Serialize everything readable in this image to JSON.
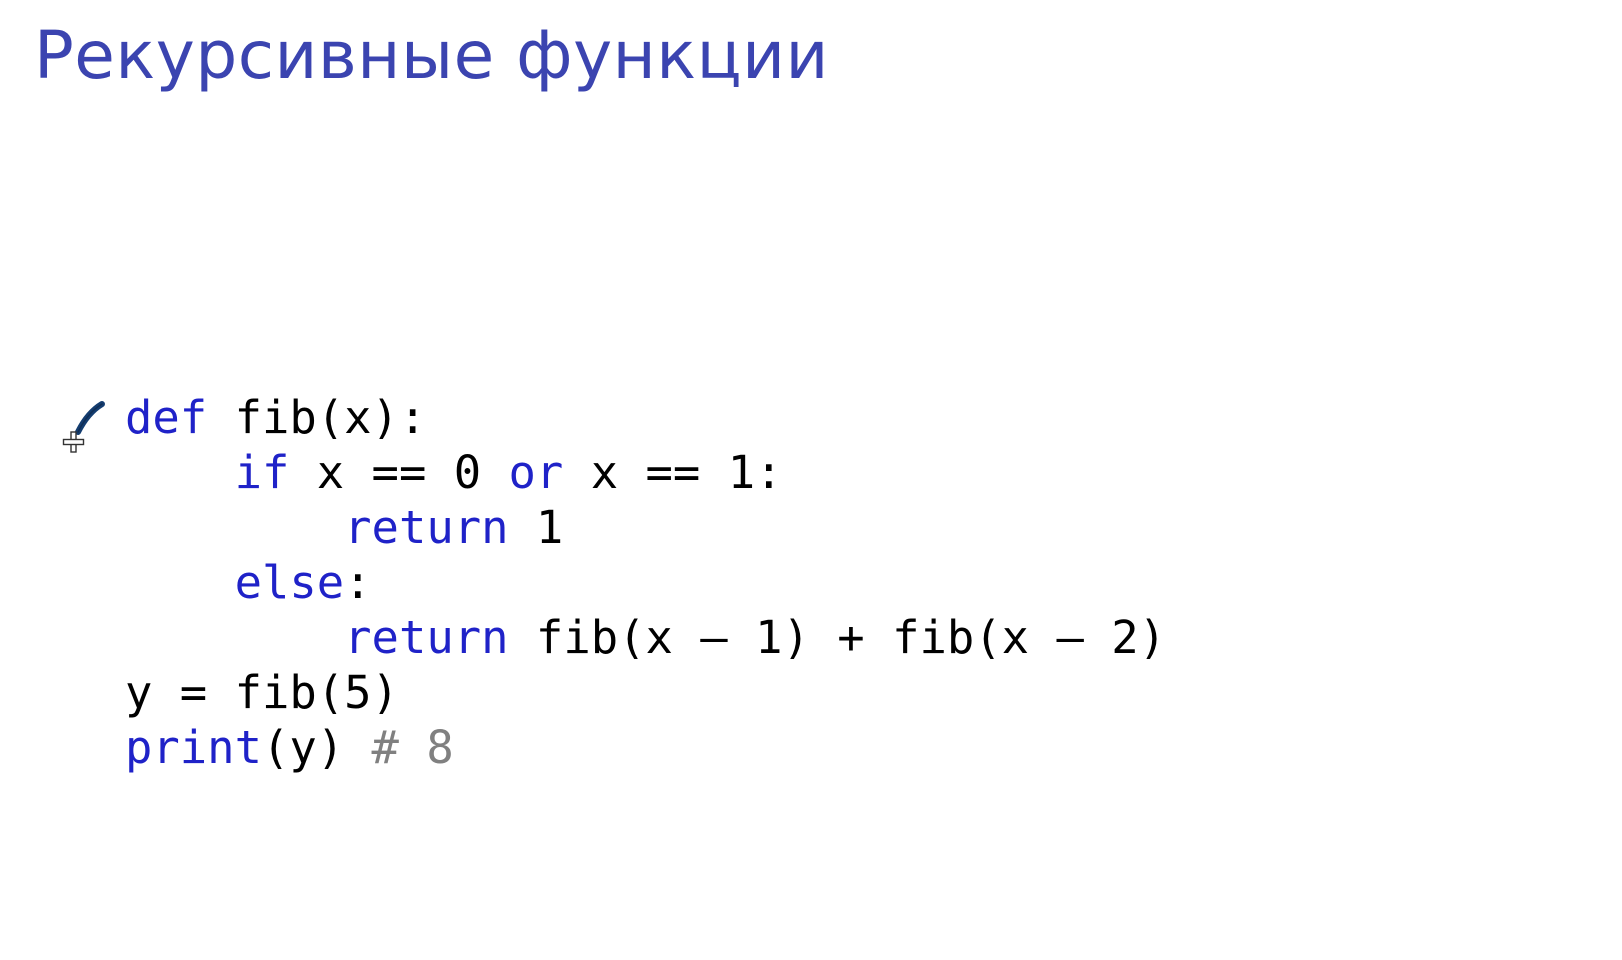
{
  "slide": {
    "title": "Рекурсивные функции"
  },
  "colors": {
    "title": "#3b44b0",
    "keyword": "#1f22c8",
    "text": "#000000",
    "comment": "#808080",
    "pen": "#143d70"
  },
  "code": {
    "lines": [
      [
        {
          "t": "def",
          "k": "keyword"
        },
        {
          "t": " fib(x):",
          "k": "text"
        }
      ],
      [
        {
          "t": "    ",
          "k": "text"
        },
        {
          "t": "if",
          "k": "keyword"
        },
        {
          "t": " x == 0 ",
          "k": "text"
        },
        {
          "t": "or",
          "k": "keyword"
        },
        {
          "t": " x == 1:",
          "k": "text"
        }
      ],
      [
        {
          "t": "        ",
          "k": "text"
        },
        {
          "t": "return",
          "k": "keyword"
        },
        {
          "t": " 1",
          "k": "text"
        }
      ],
      [
        {
          "t": "    ",
          "k": "text"
        },
        {
          "t": "else",
          "k": "keyword"
        },
        {
          "t": ":",
          "k": "text"
        }
      ],
      [
        {
          "t": "        ",
          "k": "text"
        },
        {
          "t": "return",
          "k": "keyword"
        },
        {
          "t": " fib(x ",
          "k": "text"
        },
        {
          "t": "–",
          "k": "text"
        },
        {
          "t": " 1) + fib(x ",
          "k": "text"
        },
        {
          "t": "–",
          "k": "text"
        },
        {
          "t": " 2)",
          "k": "text"
        }
      ],
      [
        {
          "t": "y = fib(5)",
          "k": "text"
        }
      ],
      [
        {
          "t": "print",
          "k": "keyword"
        },
        {
          "t": "(y) ",
          "k": "text"
        },
        {
          "t": "# 8",
          "k": "comment"
        }
      ]
    ]
  },
  "cursor": {
    "icon": "pen-cursor-icon"
  }
}
